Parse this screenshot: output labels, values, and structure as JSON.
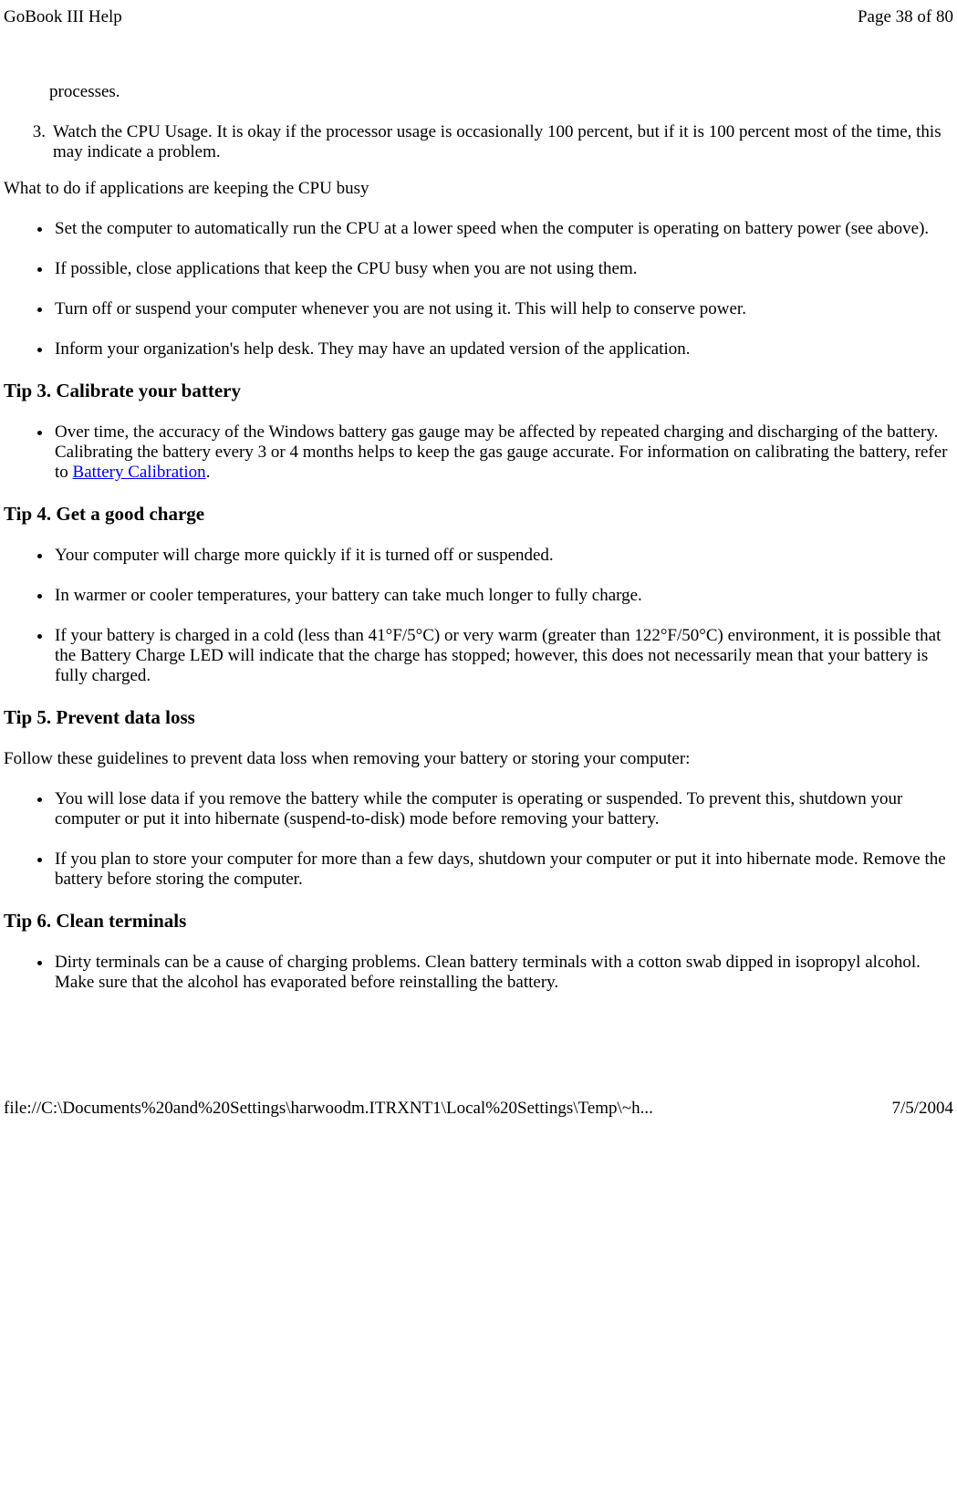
{
  "header": {
    "title": "GoBook III Help",
    "page": "Page 38 of 80"
  },
  "body": {
    "frag1": "processes.",
    "ol_item3": "Watch the CPU Usage. It is okay if the processor usage is occasionally 100 percent, but if it is 100 percent most of the time, this may indicate a problem.",
    "sub1_intro": "What to do if applications are keeping the CPU busy",
    "sub1_items": {
      "i0": "Set the computer to automatically run the CPU at a lower speed when the computer is operating on battery power (see above).",
      "i1": "If possible, close applications that keep the CPU busy when you are not using them.",
      "i2": "Turn off or suspend your computer whenever you are not using it. This will help to conserve power.",
      "i3": "Inform your organization's help desk. They may have an updated version of the application."
    },
    "tip3": {
      "heading": "Tip 3. Calibrate your battery",
      "items": {
        "i0_pre": "Over time, the accuracy of the Windows battery gas gauge may be affected by repeated charging and discharging of the battery. Calibrating the battery every 3 or 4 months helps to keep the gas gauge accurate. For information on calibrating the battery, refer to ",
        "i0_link": "Battery Calibration",
        "i0_post": "."
      }
    },
    "tip4": {
      "heading": "Tip 4. Get a good charge",
      "items": {
        "i0": "Your computer will charge more quickly if it is turned off or suspended.",
        "i1": "In warmer or cooler temperatures, your battery can take much longer to fully charge.",
        "i2": "If your battery is charged in a cold (less than 41°F/5°C) or very warm (greater than 122°F/50°C) environment, it is possible that the Battery Charge LED will indicate that the charge has stopped; however, this does not necessarily mean that your battery is fully charged."
      }
    },
    "tip5": {
      "heading": "Tip 5. Prevent data loss",
      "intro": "Follow these guidelines to prevent data loss when removing your battery or storing your computer:",
      "items": {
        "i0": "You will lose data if you remove the battery while the computer is operating or suspended. To prevent this, shutdown your computer or put it into hibernate (suspend-to-disk) mode before removing your battery.",
        "i1": "If you plan to store your computer for more than a few days, shutdown your computer or put it into hibernate mode. Remove the battery before storing the computer."
      }
    },
    "tip6": {
      "heading": "Tip 6. Clean terminals",
      "items": {
        "i0": "Dirty terminals can be a cause of charging problems. Clean battery terminals with a cotton swab dipped in isopropyl alcohol. Make sure that the alcohol has evaporated before reinstalling the battery."
      }
    }
  },
  "footer": {
    "path": "file://C:\\Documents%20and%20Settings\\harwoodm.ITRXNT1\\Local%20Settings\\Temp\\~h...",
    "date": "7/5/2004"
  }
}
